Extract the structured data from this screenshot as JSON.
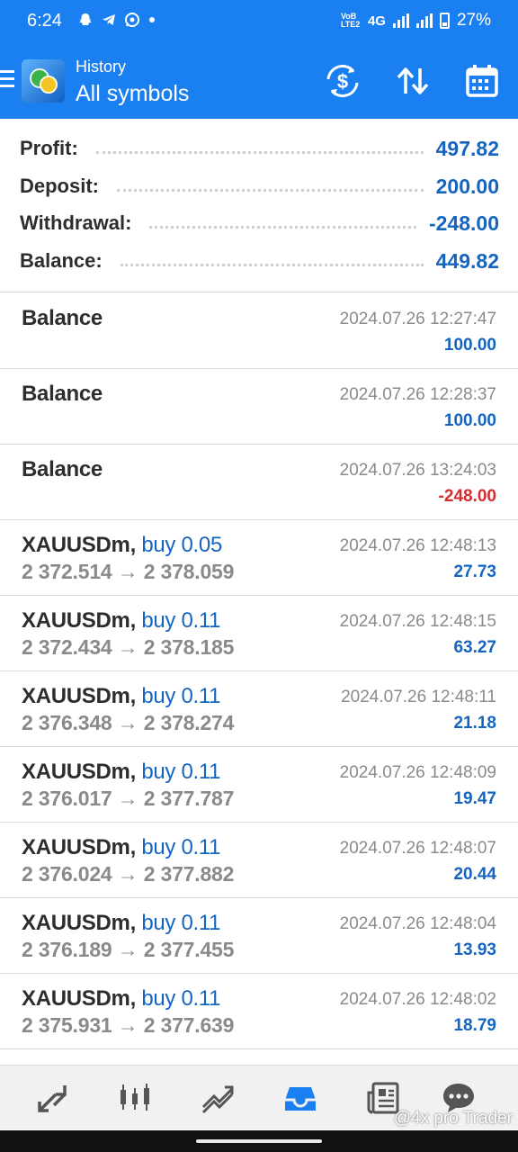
{
  "status_bar": {
    "time": "6:24",
    "network": "4G",
    "volte": "VoB LTE2",
    "battery": "27%",
    "notification_icons": [
      "snapchat-icon",
      "telegram-icon",
      "whatsapp-icon",
      "dot-icon"
    ]
  },
  "header": {
    "subtitle": "History",
    "title": "All symbols",
    "actions": [
      "currency-exchange-icon",
      "sort-icon",
      "calendar-icon"
    ],
    "color": "#1a7ff0"
  },
  "summary": {
    "profit_label": "Profit:",
    "profit_value": "497.82",
    "deposit_label": "Deposit:",
    "deposit_value": "200.00",
    "withdrawal_label": "Withdrawal:",
    "withdrawal_value": "-248.00",
    "balance_label": "Balance:",
    "balance_value": "449.82"
  },
  "deals": [
    {
      "symbol": "Balance",
      "time": "2024.07.26 12:27:47",
      "amount": "100.00",
      "negative": false
    },
    {
      "symbol": "Balance",
      "time": "2024.07.26 12:28:37",
      "amount": "100.00",
      "negative": false
    },
    {
      "symbol": "Balance",
      "time": "2024.07.26 13:24:03",
      "amount": "-248.00",
      "negative": true
    },
    {
      "symbol": "XAUUSDm,",
      "side": "buy 0.05",
      "prices": "2 372.514 → 2 378.059",
      "time": "2024.07.26 12:48:13",
      "amount": "27.73",
      "negative": false
    },
    {
      "symbol": "XAUUSDm,",
      "side": "buy 0.11",
      "prices": "2 372.434 → 2 378.185",
      "time": "2024.07.26 12:48:15",
      "amount": "63.27",
      "negative": false
    },
    {
      "symbol": "XAUUSDm,",
      "side": "buy 0.11",
      "prices": "2 376.348 → 2 378.274",
      "time": "2024.07.26 12:48:11",
      "amount": "21.18",
      "negative": false
    },
    {
      "symbol": "XAUUSDm,",
      "side": "buy 0.11",
      "prices": "2 376.017 → 2 377.787",
      "time": "2024.07.26 12:48:09",
      "amount": "19.47",
      "negative": false
    },
    {
      "symbol": "XAUUSDm,",
      "side": "buy 0.11",
      "prices": "2 376.024 → 2 377.882",
      "time": "2024.07.26 12:48:07",
      "amount": "20.44",
      "negative": false
    },
    {
      "symbol": "XAUUSDm,",
      "side": "buy 0.11",
      "prices": "2 376.189 → 2 377.455",
      "time": "2024.07.26 12:48:04",
      "amount": "13.93",
      "negative": false
    },
    {
      "symbol": "XAUUSDm,",
      "side": "buy 0.11",
      "prices": "2 375.931 → 2 377.639",
      "time": "2024.07.26 12:48:02",
      "amount": "18.79",
      "negative": false
    }
  ],
  "bottom_nav": [
    {
      "icon": "quotes-icon",
      "active": false
    },
    {
      "icon": "chart-icon",
      "active": false
    },
    {
      "icon": "trade-icon",
      "active": false
    },
    {
      "icon": "history-icon",
      "active": true
    },
    {
      "icon": "news-icon",
      "active": false
    },
    {
      "icon": "messages-icon",
      "active": false
    }
  ],
  "watermark": "@4x pro Trader",
  "colors": {
    "profit_blue": "#1565c0",
    "loss_red": "#d32f2f",
    "price_gray": "#8a8a8a"
  }
}
